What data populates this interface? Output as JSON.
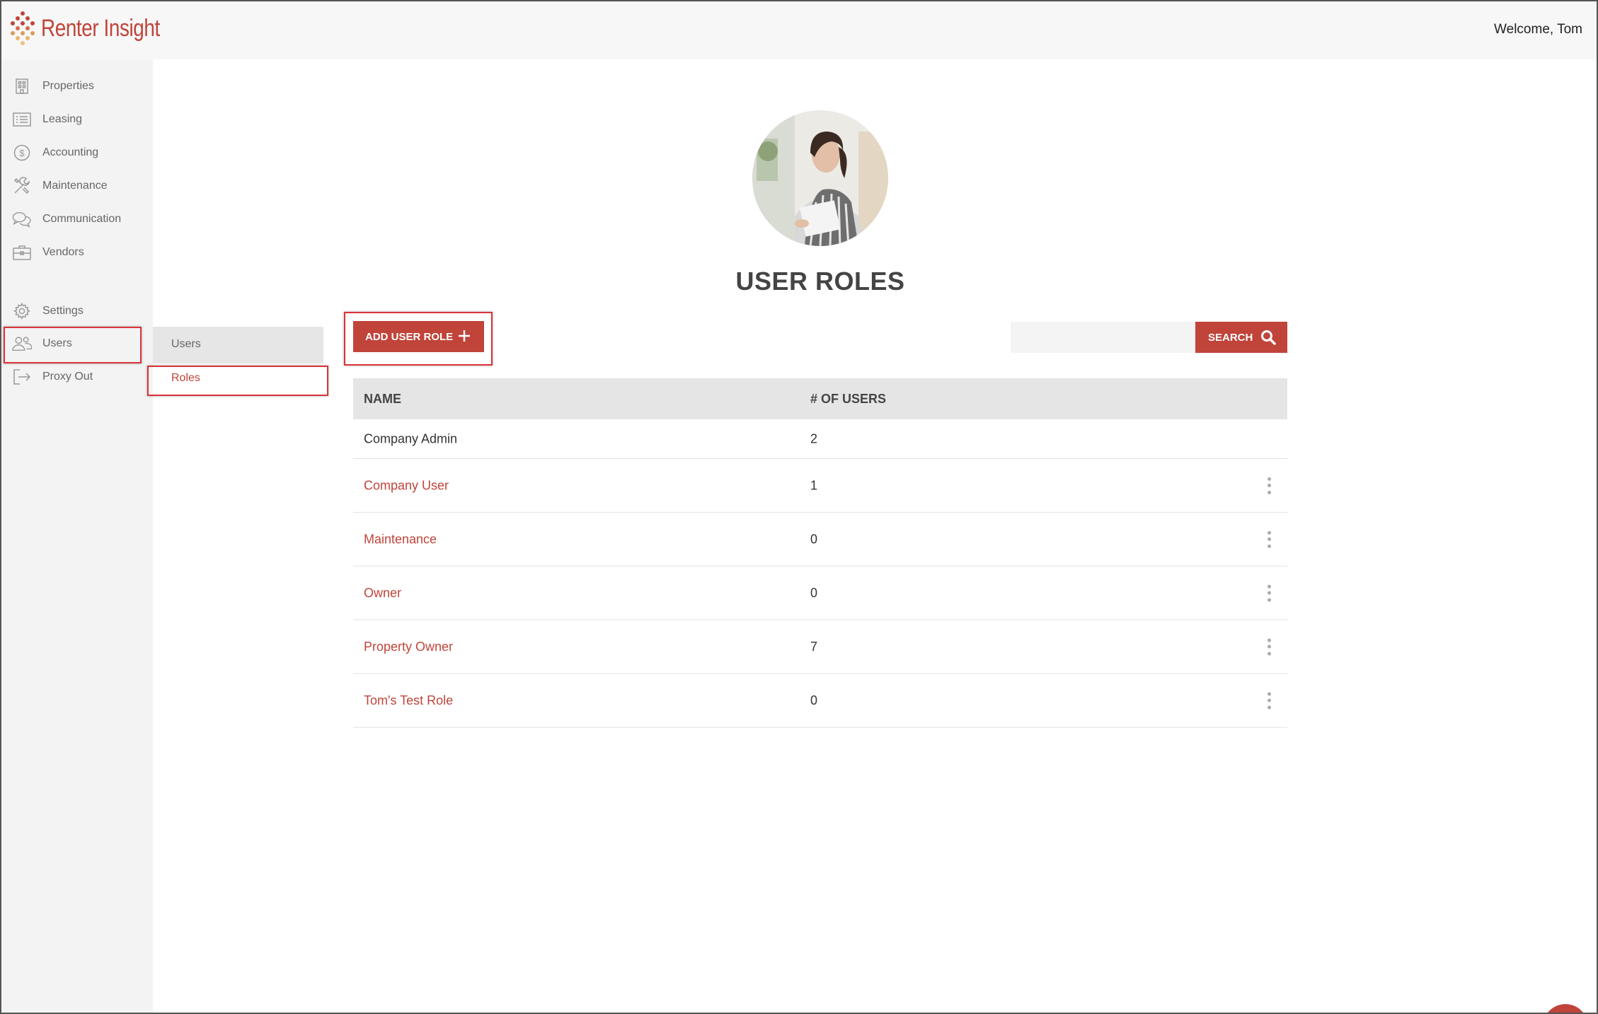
{
  "app": {
    "brand": "Renter Insight",
    "welcome": "Welcome, Tom"
  },
  "colors": {
    "accent": "#c0443a",
    "sidebar_bg": "#f3f3f3",
    "header_bg": "#f7f7f7"
  },
  "sidebar": {
    "items": [
      {
        "label": "Properties",
        "icon": "building-icon"
      },
      {
        "label": "Leasing",
        "icon": "list-icon"
      },
      {
        "label": "Accounting",
        "icon": "dollar-circle-icon"
      },
      {
        "label": "Maintenance",
        "icon": "tools-icon"
      },
      {
        "label": "Communication",
        "icon": "chat-bubbles-icon"
      },
      {
        "label": "Vendors",
        "icon": "briefcase-icon"
      },
      {
        "label": "Settings",
        "icon": "gear-icon"
      },
      {
        "label": "Users",
        "icon": "users-icon"
      },
      {
        "label": "Proxy Out",
        "icon": "sign-out-icon"
      }
    ]
  },
  "submenu": {
    "items": [
      {
        "label": "Users"
      },
      {
        "label": "Roles"
      }
    ]
  },
  "main": {
    "title": "USER ROLES",
    "add_button_label": "ADD USER ROLE",
    "search_button_label": "SEARCH",
    "search_placeholder": ""
  },
  "table": {
    "headers": [
      "NAME",
      "# OF USERS"
    ],
    "rows": [
      {
        "name": "Company Admin",
        "count": "2"
      },
      {
        "name": "Company User",
        "count": "1"
      },
      {
        "name": "Maintenance",
        "count": "0"
      },
      {
        "name": "Owner",
        "count": "0"
      },
      {
        "name": "Property Owner",
        "count": "7"
      },
      {
        "name": "Tom's Test Role",
        "count": "0"
      }
    ]
  }
}
